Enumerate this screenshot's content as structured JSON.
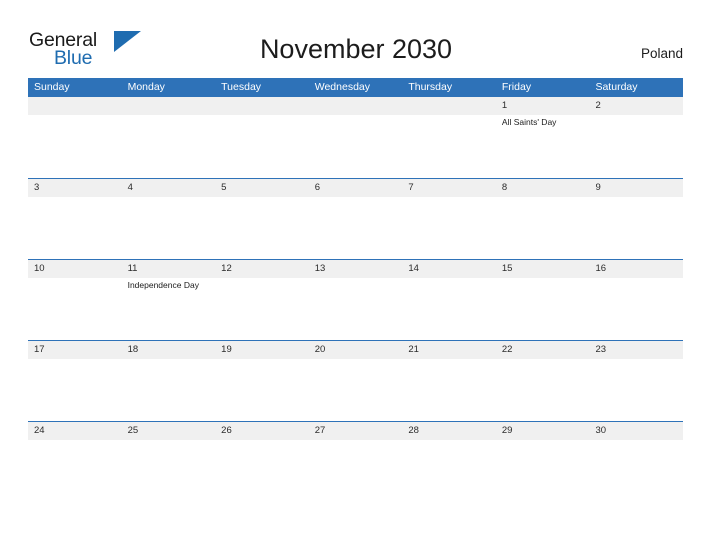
{
  "brand": {
    "name_part1": "General",
    "name_part2": "Blue",
    "accent_color": "#1f6cb0",
    "triangle_icon": "brand-triangle-icon"
  },
  "header": {
    "title": "November 2030",
    "region": "Poland"
  },
  "calendar": {
    "header_bg_color": "#2e72b8",
    "row_band_color": "#f0f0f0",
    "month": "November",
    "year": "2030",
    "day_headers": [
      "Sunday",
      "Monday",
      "Tuesday",
      "Wednesday",
      "Thursday",
      "Friday",
      "Saturday"
    ],
    "weeks": [
      {
        "days": [
          {
            "num": "",
            "event": ""
          },
          {
            "num": "",
            "event": ""
          },
          {
            "num": "",
            "event": ""
          },
          {
            "num": "",
            "event": ""
          },
          {
            "num": "",
            "event": ""
          },
          {
            "num": "1",
            "event": "All Saints' Day"
          },
          {
            "num": "2",
            "event": ""
          }
        ]
      },
      {
        "days": [
          {
            "num": "3",
            "event": ""
          },
          {
            "num": "4",
            "event": ""
          },
          {
            "num": "5",
            "event": ""
          },
          {
            "num": "6",
            "event": ""
          },
          {
            "num": "7",
            "event": ""
          },
          {
            "num": "8",
            "event": ""
          },
          {
            "num": "9",
            "event": ""
          }
        ]
      },
      {
        "days": [
          {
            "num": "10",
            "event": ""
          },
          {
            "num": "11",
            "event": "Independence Day"
          },
          {
            "num": "12",
            "event": ""
          },
          {
            "num": "13",
            "event": ""
          },
          {
            "num": "14",
            "event": ""
          },
          {
            "num": "15",
            "event": ""
          },
          {
            "num": "16",
            "event": ""
          }
        ]
      },
      {
        "days": [
          {
            "num": "17",
            "event": ""
          },
          {
            "num": "18",
            "event": ""
          },
          {
            "num": "19",
            "event": ""
          },
          {
            "num": "20",
            "event": ""
          },
          {
            "num": "21",
            "event": ""
          },
          {
            "num": "22",
            "event": ""
          },
          {
            "num": "23",
            "event": ""
          }
        ]
      },
      {
        "days": [
          {
            "num": "24",
            "event": ""
          },
          {
            "num": "25",
            "event": ""
          },
          {
            "num": "26",
            "event": ""
          },
          {
            "num": "27",
            "event": ""
          },
          {
            "num": "28",
            "event": ""
          },
          {
            "num": "29",
            "event": ""
          },
          {
            "num": "30",
            "event": ""
          }
        ]
      }
    ]
  }
}
